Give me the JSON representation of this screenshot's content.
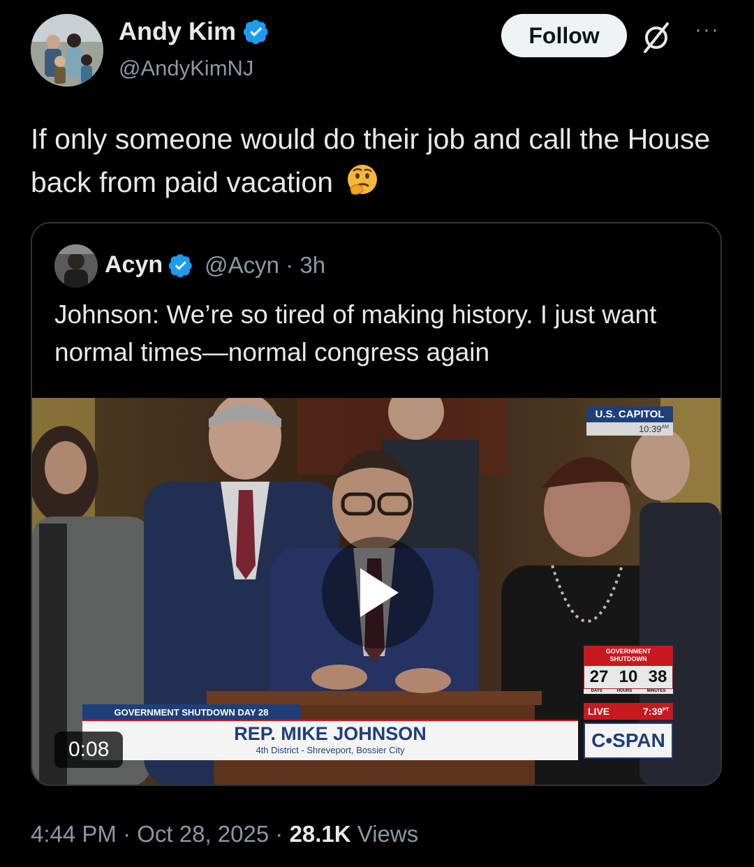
{
  "author": {
    "name": "Andy Kim",
    "handle": "@AndyKimNJ"
  },
  "actions": {
    "follow_label": "Follow",
    "more_label": "···"
  },
  "tweet": {
    "text": "If only someone would do their job and call the House back from paid vacation"
  },
  "quoted": {
    "name": "Acyn",
    "handle": "@Acyn",
    "separator": "·",
    "age": "3h",
    "text": "Johnson: We’re so tired of making history. I just want normal times—normal congress again"
  },
  "video": {
    "duration": "0:08",
    "overlay": {
      "location": "U.S. CAPITOL",
      "clock": "10:39",
      "clock_suffix": "AM",
      "banner": "GOVERNMENT SHUTDOWN DAY 28",
      "speaker_name": "REP. MIKE JOHNSON",
      "speaker_district": "4th District - Shreveport, Bossier City",
      "counter_title": "GOVERNMENT SHUTDOWN",
      "counter_days": "27",
      "counter_hours": "10",
      "counter_minutes": "38",
      "counter_days_label": "DAYS",
      "counter_hours_label": "HOURS",
      "counter_minutes_label": "MINUTES",
      "live_label": "LIVE",
      "live_time": "7:39",
      "live_suffix": "PT",
      "network": "C•SPAN"
    }
  },
  "footer": {
    "time": "4:44 PM",
    "date": "Oct 28, 2025",
    "sep": "·",
    "views_count": "28.1K",
    "views_label": "Views"
  },
  "colors": {
    "background": "#000000",
    "verified": "#1d9bf0",
    "muted": "#8b98a5"
  }
}
